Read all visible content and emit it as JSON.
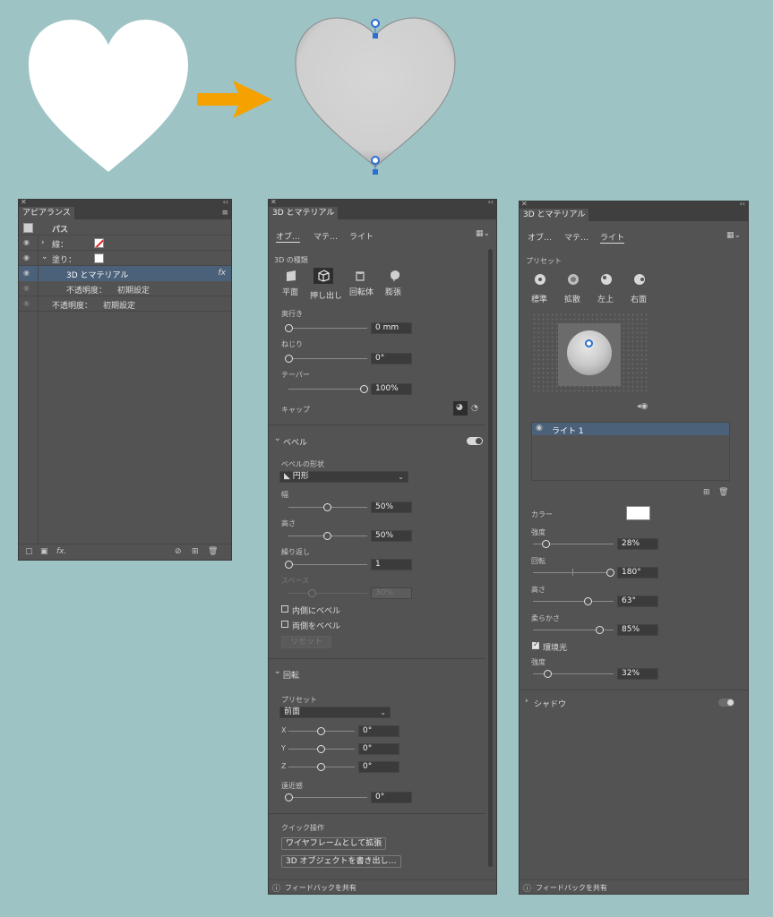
{
  "appearance": {
    "tab": "アピアランス",
    "rows": [
      {
        "label": "パス"
      },
      {
        "label": "線："
      },
      {
        "label": "塗り："
      },
      {
        "label": "3D とマテリアル",
        "fx": "fx"
      },
      {
        "label": "不透明度：",
        "value": "初期設定"
      },
      {
        "label": "不透明度：",
        "value": "初期設定"
      }
    ],
    "footer_fx": "fx."
  },
  "material_panel": {
    "tab": "3D とマテリアル",
    "subtabs": [
      "オブ…",
      "マテ…",
      "ライト"
    ],
    "type_heading": "3D の種類",
    "types": [
      "平面",
      "押し出し",
      "回転体",
      "膨張"
    ],
    "depth_label": "奥行き",
    "depth_value": "0 mm",
    "twist_label": "ねじり",
    "twist_value": "0°",
    "taper_label": "テーパー",
    "taper_value": "100%",
    "cap_label": "キャップ",
    "bevel_heading": "ベベル",
    "bevel_shape_label": "ベベルの形状",
    "bevel_shape_value": "円形",
    "width_label": "幅",
    "width_value": "50%",
    "height_label": "高さ",
    "height_value": "50%",
    "repeat_label": "繰り返し",
    "repeat_value": "1",
    "space_label": "スペース",
    "space_value": "30%",
    "inner_bevel": "内側にベベル",
    "both_bevel": "両側をベベル",
    "reset": "リセット",
    "rotation_heading": "回転",
    "preset_label": "プリセット",
    "preset_value": "前面",
    "x_label": "X",
    "x_value": "0°",
    "y_label": "Y",
    "y_value": "0°",
    "z_label": "Z",
    "z_value": "0°",
    "perspective_label": "遠近感",
    "perspective_value": "0°",
    "quick_heading": "クイック操作",
    "wireframe_btn": "ワイヤフレームとして拡張",
    "export_btn": "3D オブジェクトを書き出し…",
    "feedback": "フィードバックを共有"
  },
  "light_panel": {
    "tab": "3D とマテリアル",
    "subtabs": [
      "オブ…",
      "マテ…",
      "ライト"
    ],
    "preset_heading": "プリセット",
    "presets": [
      "標準",
      "拡散",
      "左上",
      "右面"
    ],
    "light_item": "ライト 1",
    "color_label": "カラー",
    "color_value": "#ffffff",
    "intensity_label": "強度",
    "intensity_value": "28%",
    "rotation_label": "回転",
    "rotation_value": "180°",
    "height_label": "高さ",
    "height_value": "63°",
    "softness_label": "柔らかさ",
    "softness_value": "85%",
    "ambient_label": "環境光",
    "ambient_intensity_label": "強度",
    "ambient_intensity_value": "32%",
    "shadow_heading": "シャドウ",
    "feedback": "フィードバックを共有"
  },
  "colors": {
    "arrow": "#f5a100",
    "background": "#9dc3c4",
    "panel": "#535353",
    "selected_row": "#4b6079"
  }
}
